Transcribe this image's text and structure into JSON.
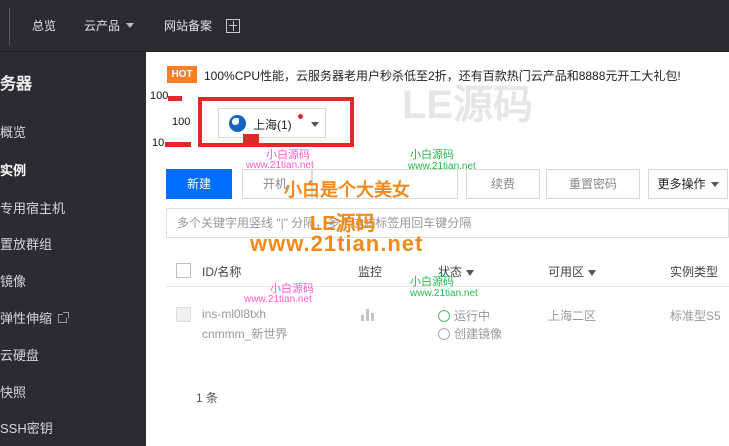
{
  "topbar": {
    "nav": [
      {
        "label": "总览"
      },
      {
        "label": "云产品"
      },
      {
        "label": "网站备案"
      }
    ]
  },
  "sidebar": {
    "title": "务器",
    "items": [
      {
        "label": "概览"
      },
      {
        "label": "实例"
      },
      {
        "label": "专用宿主机"
      },
      {
        "label": "置放群组"
      },
      {
        "label": "镜像"
      },
      {
        "label": "弹性伸缩"
      },
      {
        "label": "云硬盘"
      },
      {
        "label": "快照"
      },
      {
        "label": "SSH密钥"
      }
    ]
  },
  "main": {
    "banner": {
      "badge": "HOT",
      "text": "100%CPU性能，云服务器老用户秒杀低至2折，还有百款热门云产品和8888元开工大礼包!"
    },
    "region": {
      "label": "上海(1)"
    },
    "left_numbers": [
      "100",
      "100",
      "10"
    ],
    "toolbar": {
      "new": "新建",
      "start": "开机",
      "renew": "续费",
      "reset_password": "重置密码",
      "more": "更多操作"
    },
    "search": {
      "placeholder": "多个关键字用竖线 \"|\" 分隔，多个过滤标签用回车键分隔"
    },
    "table": {
      "headers": {
        "id_name": "ID/名称",
        "monitor": "监控",
        "status": "状态",
        "zone": "可用区",
        "type": "实例类型"
      },
      "rows": [
        {
          "id": "ins-ml0l8txh",
          "name": "cnmmm_新世界",
          "status": "运行中",
          "substatus": "创建镜像",
          "zone": "上海二区",
          "type": "标准型S5"
        }
      ]
    },
    "count": "1 条"
  },
  "watermarks": {
    "pink_small": "小白源码",
    "url_small": "www.21tian.net",
    "green_small": "小白源码",
    "headline": "小白是个大美女",
    "logo": "LE源码",
    "url_big": "www.21tian.net"
  }
}
